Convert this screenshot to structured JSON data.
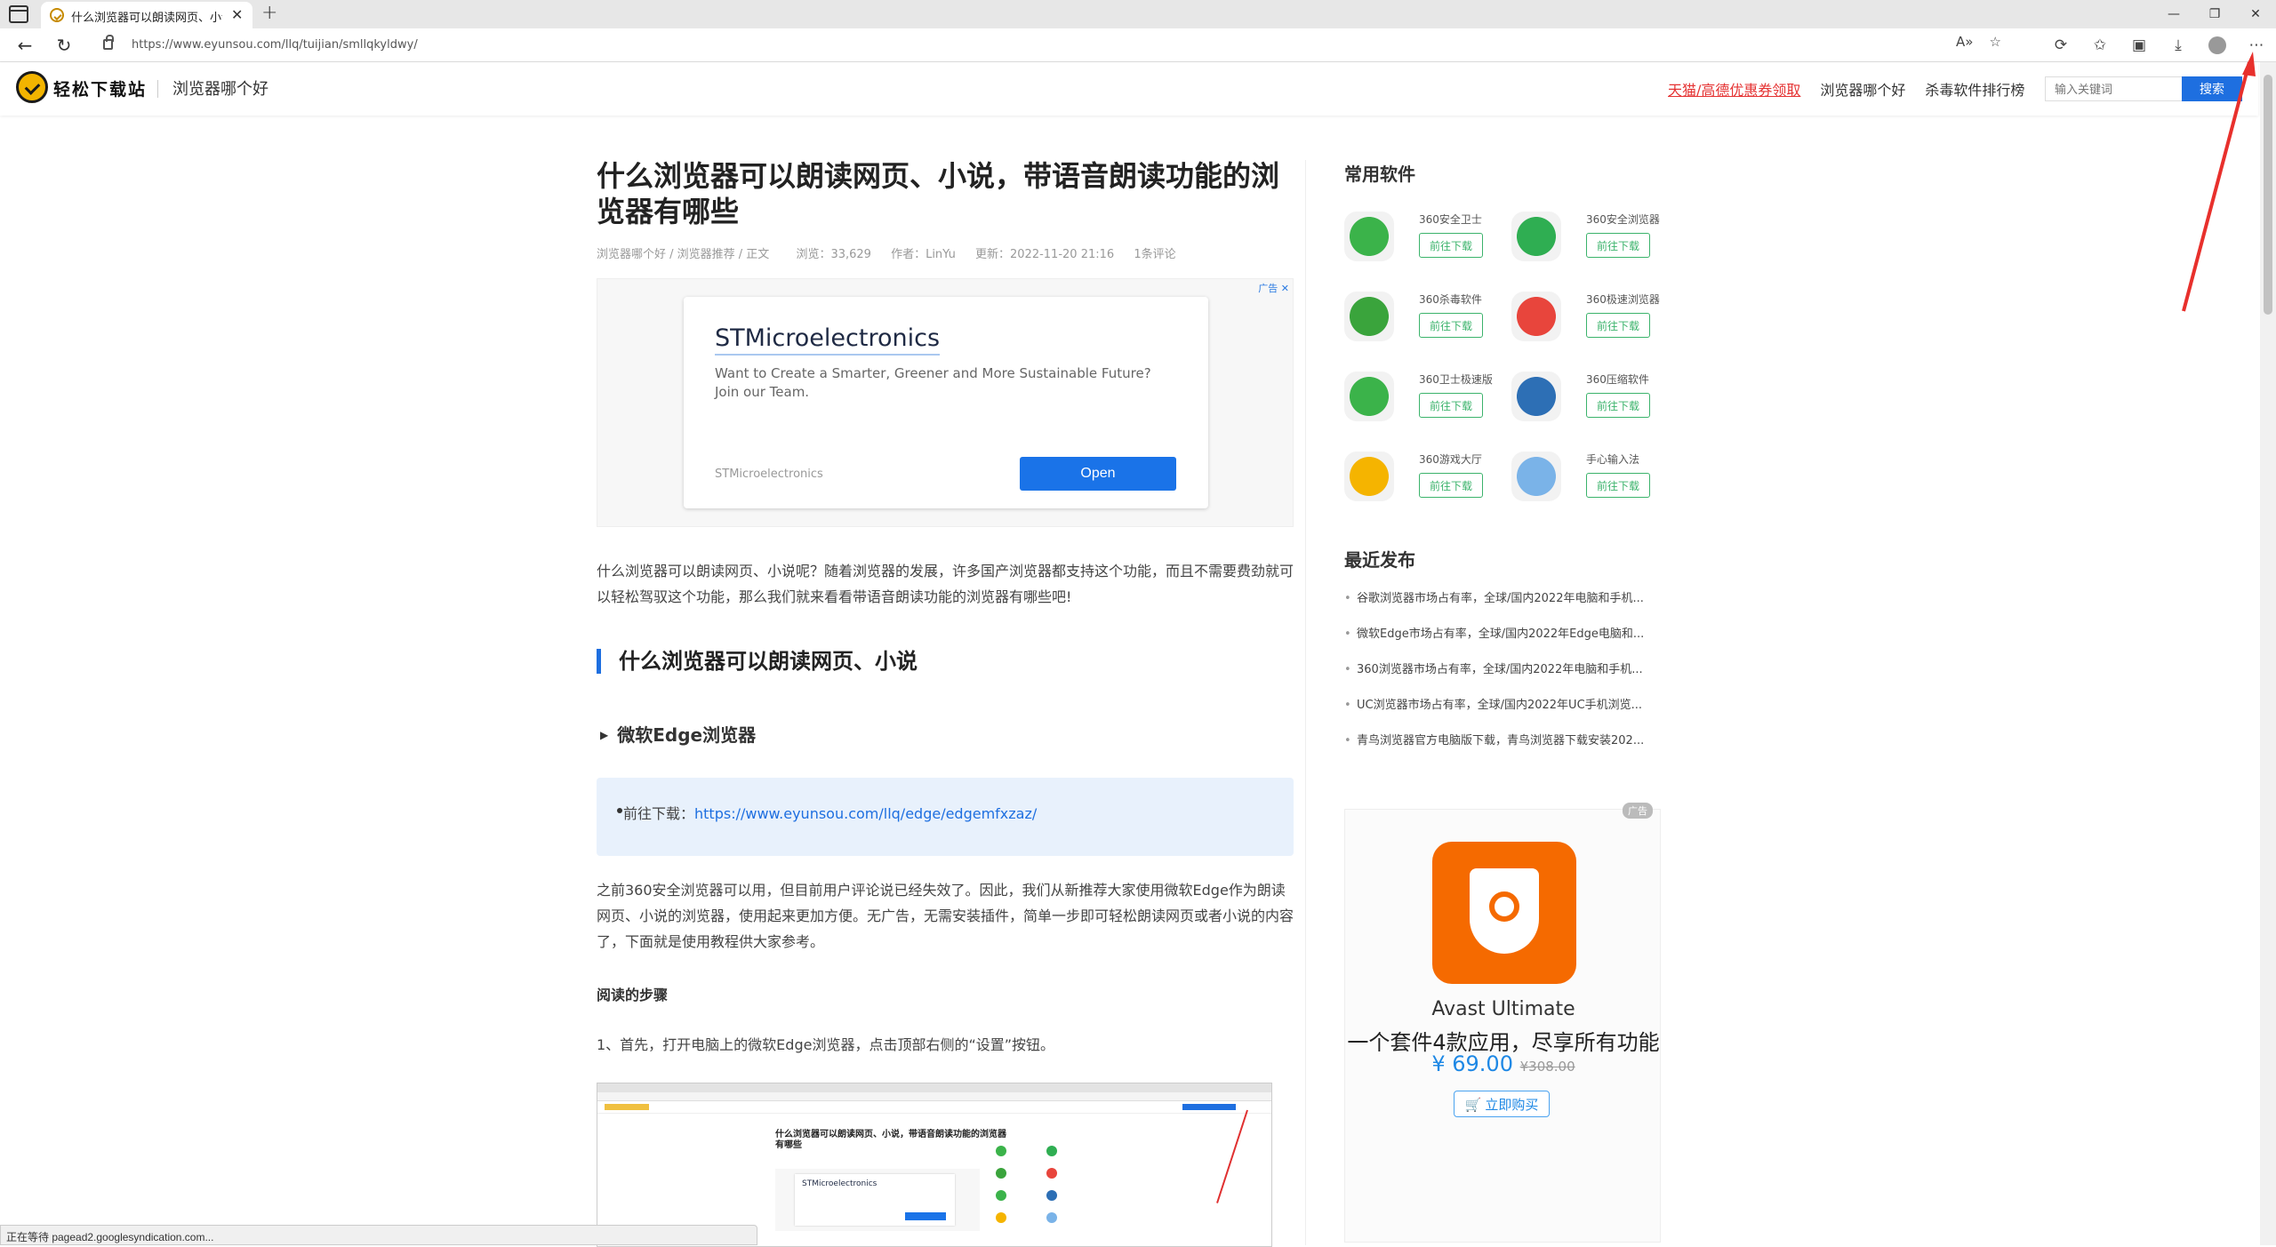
{
  "browser": {
    "tab_title": "什么浏览器可以朗读网页、小说",
    "url": "https://www.eyunsou.com/llq/tuijian/smllqkyldwy/"
  },
  "site": {
    "logo_text": "轻松下载站",
    "section": "浏览器哪个好",
    "nav": [
      "天猫/高德优惠券领取",
      "浏览器哪个好",
      "杀毒软件排行榜"
    ],
    "search_placeholder": "输入关键词",
    "search_button": "搜索"
  },
  "article": {
    "title": "什么浏览器可以朗读网页、小说，带语音朗读功能的浏览器有哪些",
    "breadcrumb": "浏览器哪个好 / 浏览器推荐 / 正文",
    "views": "浏览：33,629",
    "author": "作者：LinYu",
    "updated": "更新：2022-11-20 21:16",
    "comments": "1条评论",
    "intro": "什么浏览器可以朗读网页、小说呢？随着浏览器的发展，许多国产浏览器都支持这个功能，而且不需要费劲就可以轻松驾驭这个功能，那么我们就来看看带语音朗读功能的浏览器有哪些吧!",
    "h2": "什么浏览器可以朗读网页、小说",
    "h3": "微软Edge浏览器",
    "download_label": "前往下载：",
    "download_link": "https://www.eyunsou.com/llq/edge/edgemfxzaz/",
    "body_para": "之前360安全浏览器可以用，但目前用户评论说已经失效了。因此，我们从新推荐大家使用微软Edge作为朗读网页、小说的浏览器，使用起来更加方便。无广告，无需安装插件，简单一步即可轻松朗读网页或者小说的内容了，下面就是使用教程供大家参考。",
    "steps_heading": "阅读的步骤",
    "step1": "1、首先，打开电脑上的微软Edge浏览器，点击顶部右侧的“设置”按钮。"
  },
  "ad": {
    "brand": "STMicroelectronics",
    "description": "Want to Create a Smarter, Greener and More Sustainable Future? Join our Team.",
    "source": "STMicroelectronics",
    "button": "Open",
    "choices_label": "广告 ✕"
  },
  "thumb": {
    "title": "什么浏览器可以朗读网页、小说，带语音朗读功能的浏览器有哪些",
    "ad_brand": "STMicroelectronics"
  },
  "sidebar": {
    "common_title": "常用软件",
    "download_label": "前往下载",
    "software": [
      {
        "name": "360安全卫士",
        "color": "#3bb34a"
      },
      {
        "name": "360安全浏览器",
        "color": "#2fae52"
      },
      {
        "name": "360杀毒软件",
        "color": "#3aa43c"
      },
      {
        "name": "360极速浏览器",
        "color": "#e8453c"
      },
      {
        "name": "360卫士极速版",
        "color": "#3bb34a"
      },
      {
        "name": "360压缩软件",
        "color": "#2d6fb5"
      },
      {
        "name": "360游戏大厅",
        "color": "#f5b400"
      },
      {
        "name": "手心输入法",
        "color": "#7ab3e8"
      }
    ],
    "recent_title": "最近发布",
    "recent": [
      "谷歌浏览器市场占有率，全球/国内2022年电脑和手机...",
      "微软Edge市场占有率，全球/国内2022年Edge电脑和...",
      "360浏览器市场占有率，全球/国内2022年电脑和手机...",
      "UC浏览器市场占有率，全球/国内2022年UC手机浏览...",
      "青鸟浏览器官方电脑版下载，青鸟浏览器下载安装202..."
    ],
    "avast": {
      "tag": "广告",
      "name": "Avast Ultimate",
      "slogan": "一个套件4款应用，尽享所有功能",
      "price": "¥ 69.00",
      "old_price": "¥308.00",
      "buy": "立即购买",
      "brand_color": "#f56a00"
    }
  },
  "status": {
    "text": "正在等待 pagead2.googlesyndication.com..."
  }
}
